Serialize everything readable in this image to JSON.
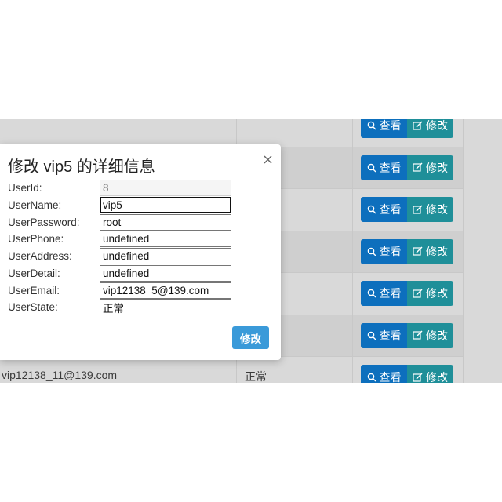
{
  "table": {
    "rows": [
      {
        "email": "",
        "state": ""
      },
      {
        "email": "",
        "state": ""
      },
      {
        "email": "",
        "state": ""
      },
      {
        "email": "",
        "state": ""
      },
      {
        "email": "",
        "state": ""
      },
      {
        "email": "",
        "state": ""
      },
      {
        "email": "vip12138_11@139.com",
        "state": "正常"
      }
    ],
    "view_label": "查看",
    "edit_label": "修改"
  },
  "modal": {
    "title": "修改 vip5 的详细信息",
    "close_glyph": "×",
    "fields": [
      {
        "label": "UserId:",
        "value": "8"
      },
      {
        "label": "UserName:",
        "value": "vip5"
      },
      {
        "label": "UserPassword:",
        "value": "root"
      },
      {
        "label": "UserPhone:",
        "value": "undefined"
      },
      {
        "label": "UserAddress:",
        "value": "undefined"
      },
      {
        "label": "UserDetail:",
        "value": "undefined"
      },
      {
        "label": "UserEmail:",
        "value": "vip12138_5@139.com"
      },
      {
        "label": "UserState:",
        "value": "正常"
      }
    ],
    "submit_label": "修改"
  },
  "colors": {
    "view_button": "#0d6fbd",
    "edit_button": "#1f8f99",
    "submit_button": "#3a9ad9",
    "backdrop": "#d9d9d9"
  },
  "icons": {
    "view": "search-icon",
    "edit": "edit-icon",
    "close": "close-icon"
  }
}
